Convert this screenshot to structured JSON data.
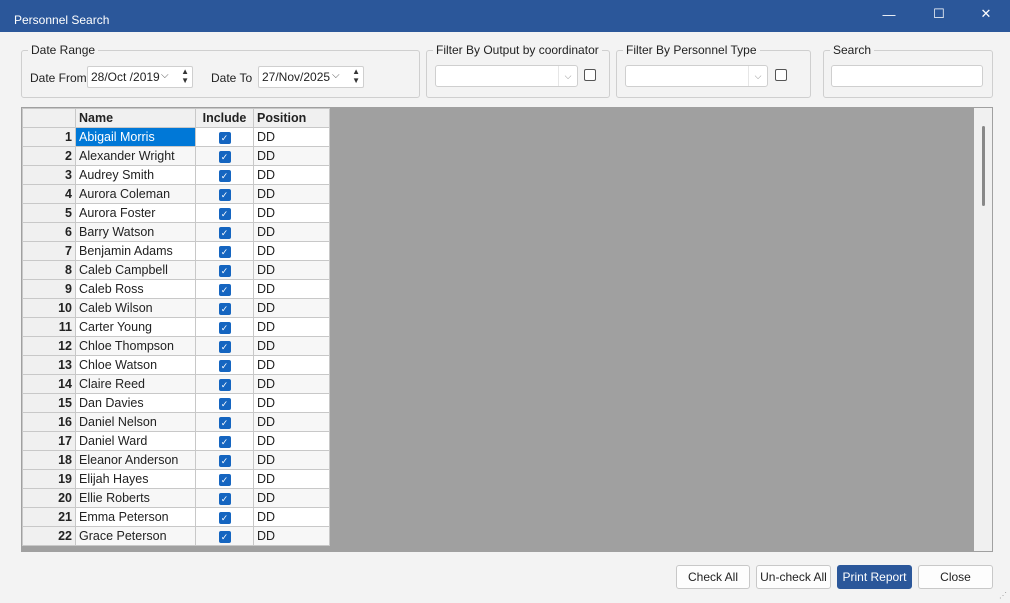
{
  "window": {
    "title": "Personnel Search",
    "minimize": "—",
    "maximize": "☐",
    "close": "✕"
  },
  "date_range": {
    "legend": "Date Range",
    "from_label": "Date From",
    "from_value": "28/Oct /2019",
    "to_label": "Date To",
    "to_value": "27/Nov/2025"
  },
  "filter_coordinator": {
    "legend": "Filter By Output by coordinator",
    "value": "",
    "checked": false
  },
  "filter_type": {
    "legend": "Filter By Personnel Type",
    "value": "",
    "checked": false
  },
  "search": {
    "legend": "Search",
    "value": "",
    "placeholder": ""
  },
  "grid": {
    "headers": {
      "name": "Name",
      "include": "Include",
      "position": "Position"
    },
    "selected_row": 1,
    "rows": [
      {
        "num": "1",
        "name": "Abigail Morris",
        "include": true,
        "position": "DD"
      },
      {
        "num": "2",
        "name": "Alexander Wright",
        "include": true,
        "position": "DD"
      },
      {
        "num": "3",
        "name": "Audrey Smith",
        "include": true,
        "position": "DD"
      },
      {
        "num": "4",
        "name": "Aurora Coleman",
        "include": true,
        "position": "DD"
      },
      {
        "num": "5",
        "name": "Aurora Foster",
        "include": true,
        "position": "DD"
      },
      {
        "num": "6",
        "name": "Barry Watson",
        "include": true,
        "position": "DD"
      },
      {
        "num": "7",
        "name": "Benjamin Adams",
        "include": true,
        "position": "DD"
      },
      {
        "num": "8",
        "name": "Caleb Campbell",
        "include": true,
        "position": "DD"
      },
      {
        "num": "9",
        "name": "Caleb Ross",
        "include": true,
        "position": "DD"
      },
      {
        "num": "10",
        "name": "Caleb Wilson",
        "include": true,
        "position": "DD"
      },
      {
        "num": "11",
        "name": "Carter Young",
        "include": true,
        "position": "DD"
      },
      {
        "num": "12",
        "name": "Chloe Thompson",
        "include": true,
        "position": "DD"
      },
      {
        "num": "13",
        "name": "Chloe Watson",
        "include": true,
        "position": "DD"
      },
      {
        "num": "14",
        "name": "Claire Reed",
        "include": true,
        "position": "DD"
      },
      {
        "num": "15",
        "name": "Dan Davies",
        "include": true,
        "position": "DD"
      },
      {
        "num": "16",
        "name": "Daniel Nelson",
        "include": true,
        "position": "DD"
      },
      {
        "num": "17",
        "name": "Daniel Ward",
        "include": true,
        "position": "DD"
      },
      {
        "num": "18",
        "name": "Eleanor Anderson",
        "include": true,
        "position": "DD"
      },
      {
        "num": "19",
        "name": "Elijah Hayes",
        "include": true,
        "position": "DD"
      },
      {
        "num": "20",
        "name": "Ellie Roberts",
        "include": true,
        "position": "DD"
      },
      {
        "num": "21",
        "name": "Emma Peterson",
        "include": true,
        "position": "DD"
      },
      {
        "num": "22",
        "name": "Grace Peterson",
        "include": true,
        "position": "DD"
      }
    ]
  },
  "buttons": {
    "check_all": "Check All",
    "uncheck_all": "Un-check All",
    "print_report": "Print Report",
    "close": "Close"
  },
  "colors": {
    "titlebar": "#2b579a",
    "selection": "#0078d7",
    "checkbox": "#1565c0"
  }
}
